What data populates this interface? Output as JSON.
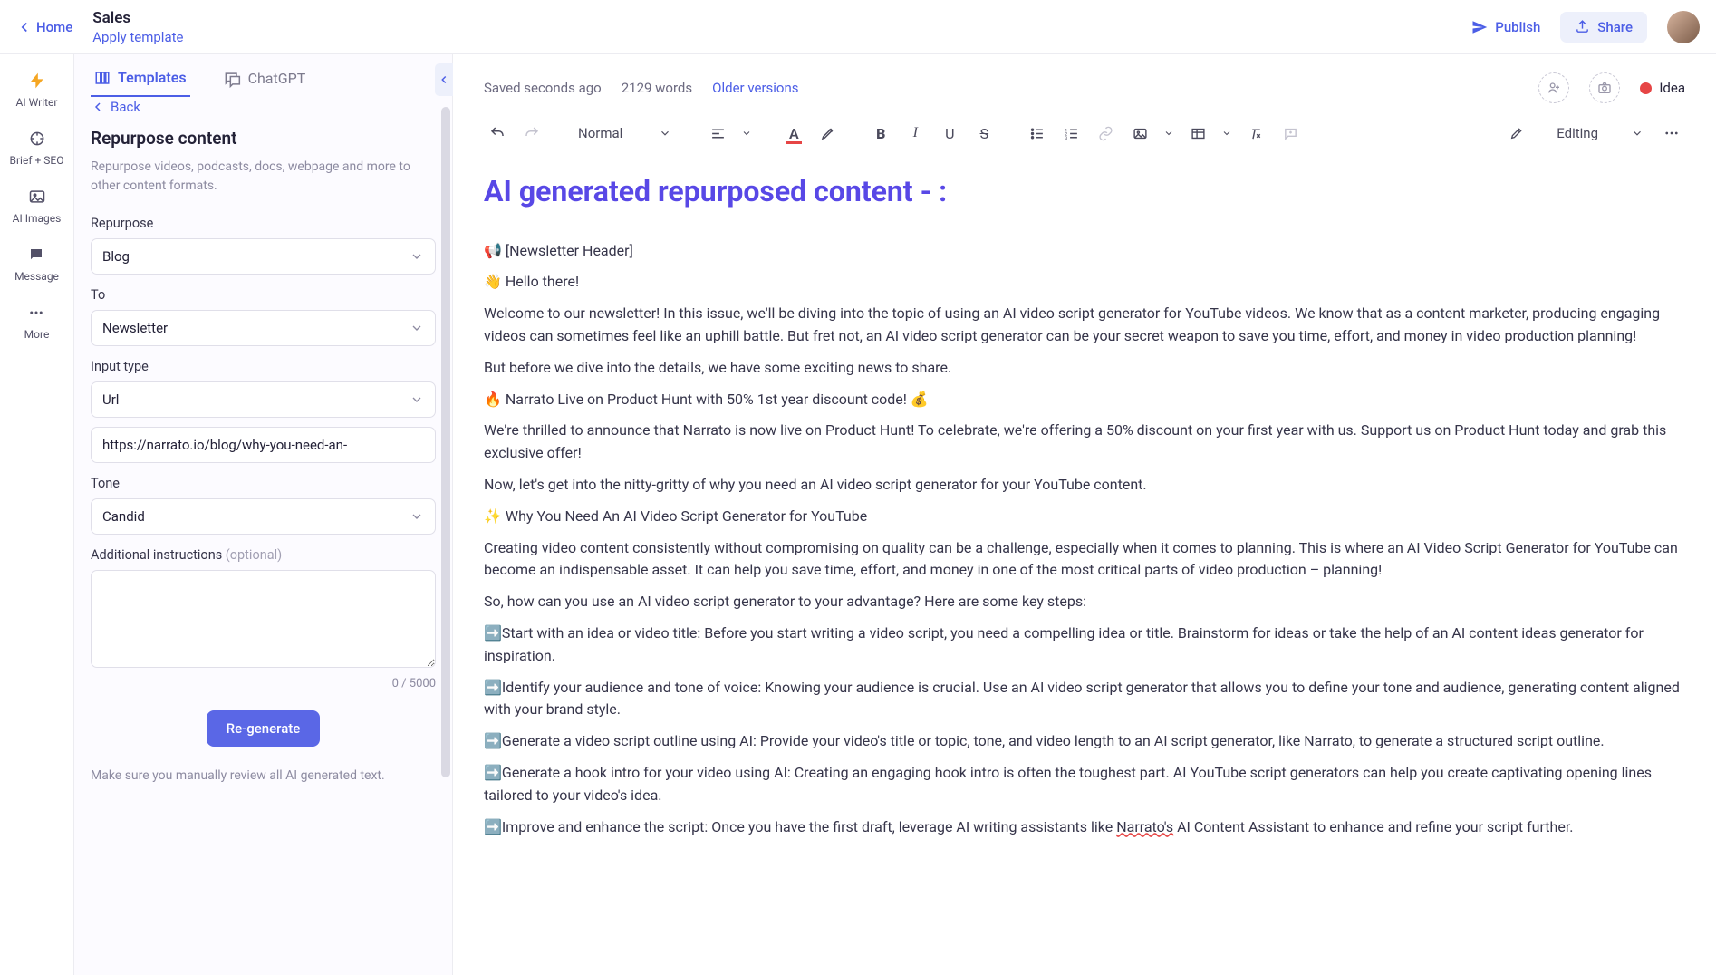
{
  "header": {
    "home": "Home",
    "title": "Sales",
    "apply_template": "Apply template",
    "publish": "Publish",
    "share": "Share"
  },
  "vnav": {
    "ai_writer": "AI Writer",
    "brief_seo": "Brief + SEO",
    "ai_images": "AI Images",
    "message": "Message",
    "more": "More"
  },
  "sidebar": {
    "tabs": {
      "templates": "Templates",
      "chatgpt": "ChatGPT"
    },
    "back": "Back",
    "panel_title": "Repurpose content",
    "panel_desc": "Repurpose videos, podcasts, docs, webpage and more to other content formats.",
    "labels": {
      "repurpose": "Repurpose",
      "to": "To",
      "input_type": "Input type",
      "tone": "Tone",
      "additional": "Additional instructions",
      "optional": "(optional)"
    },
    "values": {
      "repurpose": "Blog",
      "to": "Newsletter",
      "input_type": "Url",
      "url": "https://narrato.io/blog/why-you-need-an-",
      "tone": "Candid",
      "additional": ""
    },
    "counter": "0 / 5000",
    "regenerate": "Re-generate",
    "review_note": "Make sure you manually review all AI generated text."
  },
  "editor_top": {
    "saved": "Saved seconds ago",
    "word_count": "2129 words",
    "older_versions": "Older versions",
    "status": "Idea"
  },
  "toolbar": {
    "block_type": "Normal",
    "mode": "Editing"
  },
  "content": {
    "title": "AI generated repurposed content - :",
    "p1": "📢 [Newsletter Header]",
    "p2": "👋 Hello there!",
    "p3": "Welcome to our newsletter! In this issue, we'll be diving into the topic of using an AI video script generator for YouTube videos. We know that as a content marketer, producing engaging videos can sometimes feel like an uphill battle. But fret not, an AI video script generator can be your secret weapon to save you time, effort, and money in video production planning!",
    "p4": "But before we dive into the details, we have some exciting news to share.",
    "p5": "🔥 Narrato Live on Product Hunt with 50% 1st year discount code! 💰",
    "p6": "We're thrilled to announce that Narrato is now live on Product Hunt! To celebrate, we're offering a 50% discount on your first year with us. Support us on Product Hunt today and grab this exclusive offer!",
    "p7": "Now, let's get into the nitty-gritty of why you need an AI video script generator for your YouTube content.",
    "p8": "✨ Why You Need An AI Video Script Generator for YouTube",
    "p9": "Creating video content consistently without compromising on quality can be a challenge, especially when it comes to planning. This is where an AI Video Script Generator for YouTube can become an indispensable asset. It can help you save time, effort, and money in one of the most critical parts of video production – planning!",
    "p10": "So, how can you use an AI video script generator to your advantage? Here are some key steps:",
    "p11": "➡️Start with an idea or video title: Before you start writing a video script, you need a compelling idea or title. Brainstorm for ideas or take the help of an AI content ideas generator for inspiration.",
    "p12": "➡️Identify your audience and tone of voice: Knowing your audience is crucial. Use an AI video script generator that allows you to define your tone and audience, generating content aligned with your brand style.",
    "p13": "➡️Generate a video script outline using AI: Provide your video's title or topic, tone, and video length to an AI script generator, like Narrato, to generate a structured script outline.",
    "p14": "➡️Generate a hook intro for your video using AI: Creating an engaging hook intro is often the toughest part. AI YouTube script generators can help you create captivating opening lines tailored to your video's idea.",
    "p15a": "➡️Improve and enhance the script: Once you have the first draft, leverage AI writing assistants like ",
    "p15b": "Narrato's",
    "p15c": " AI Content Assistant to enhance and refine your script further."
  }
}
